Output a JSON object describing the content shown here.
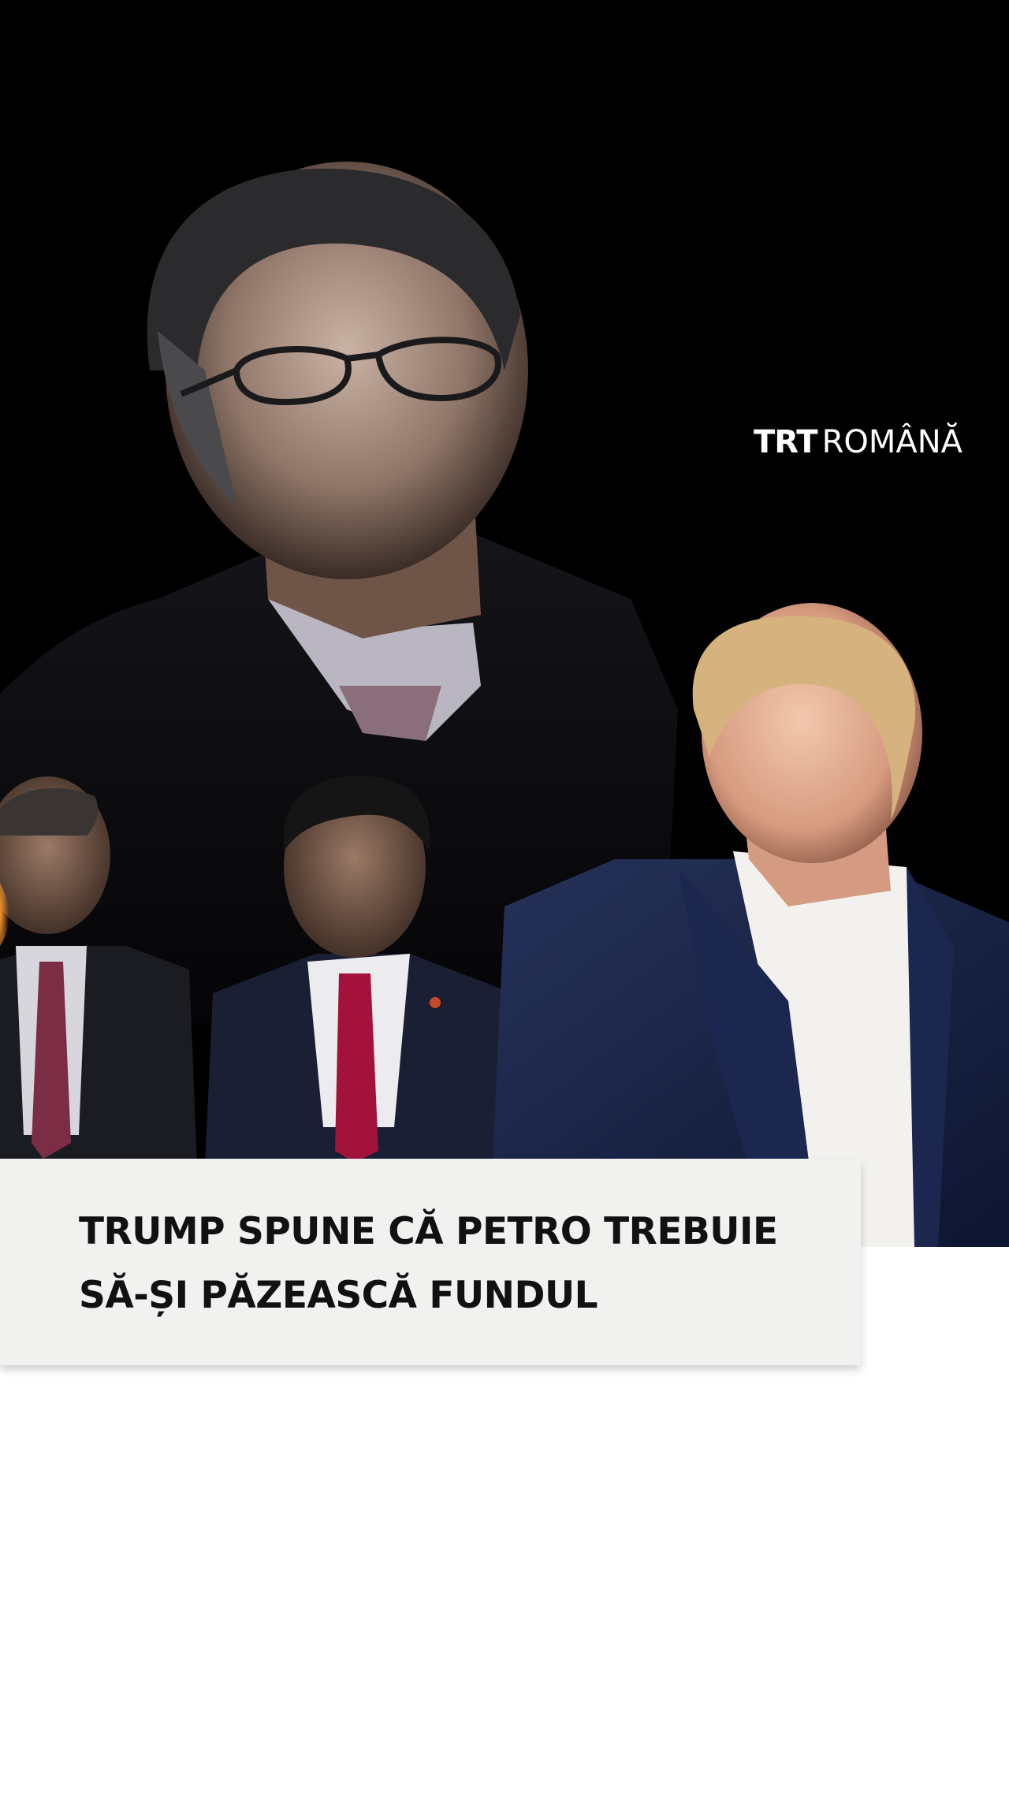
{
  "logo": {
    "brand": "TRT",
    "edition": "ROMÂNĂ"
  },
  "headline": {
    "line1": "TRUMP SPUNE CĂ PETRO TREBUIE",
    "line2": "SĂ-ȘI PĂZEASCĂ FUNDUL"
  },
  "colors": {
    "background": "#000000",
    "card": "#f1f1f0",
    "headline_text": "#111111",
    "logo_text": "#ffffff"
  }
}
